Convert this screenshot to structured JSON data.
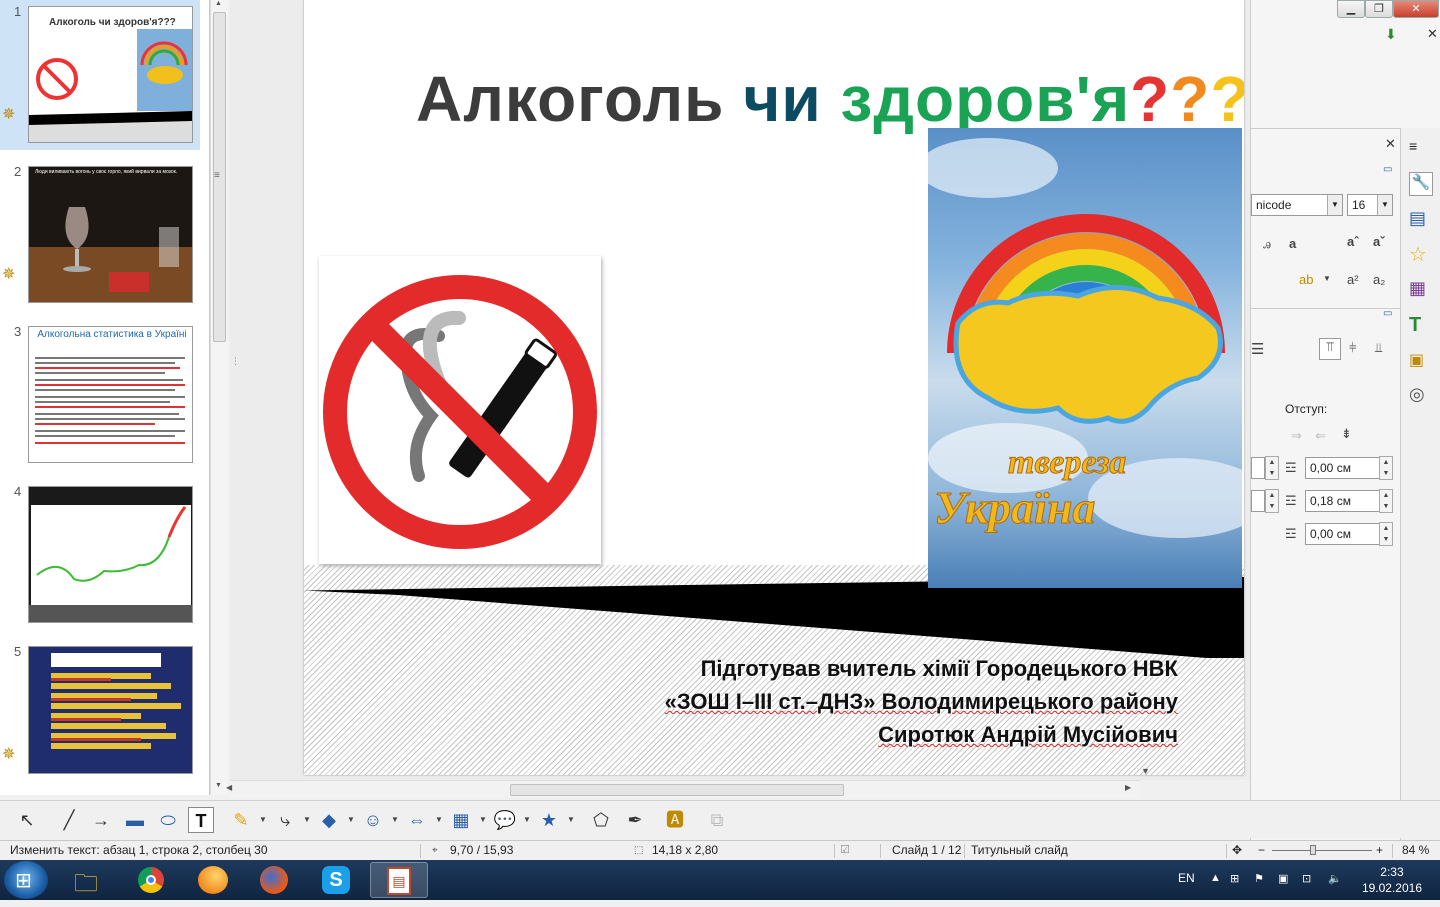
{
  "slide_title": {
    "part1": "Алкоголь ",
    "part2": "чи ",
    "part3": "здоров'я",
    "q1": "?",
    "q2": "?",
    "q3": "?"
  },
  "credit": {
    "line1": "Підготував вчитель хімії Городецького НВК",
    "line2": "«ЗОШ І–ІІІ ст.–ДНЗ» Володимирецького району",
    "line3": "Сиротюк  Андрій Мусійович"
  },
  "poster": {
    "word1": "твереза",
    "word2": "Україна"
  },
  "thumbnails": [
    {
      "num": "1",
      "title": "Алкоголь чи здоров'я???"
    },
    {
      "num": "2",
      "title": "Люди виливають вогонь у своє горло, який вирвали за мозок."
    },
    {
      "num": "3",
      "title": "Алкогольна статистика в Україні"
    },
    {
      "num": "4",
      "title": ""
    },
    {
      "num": "5",
      "title": ""
    }
  ],
  "sidebar": {
    "font_name": "nicode",
    "font_size": "16",
    "indent_label": "Отступ:",
    "indent_before": "0,00 см",
    "indent_after": "0,18 см",
    "first_line": "0,00 см"
  },
  "statusbar": {
    "edit_text": "Изменить текст: абзац 1, строка 2, столбец 30",
    "position": "9,70 / 15,93",
    "size": "14,18 x 2,80",
    "slide": "Слайд 1 / 12",
    "layout": "Титульный слайд",
    "zoom": "84 %"
  },
  "taskbar": {
    "lang": "EN",
    "time": "2:33",
    "date": "19.02.2016"
  },
  "colors": {
    "title_dark": "#3c3c3c",
    "title_teal": "#0d4b62",
    "title_green": "#1aa355",
    "red": "#e53434"
  }
}
